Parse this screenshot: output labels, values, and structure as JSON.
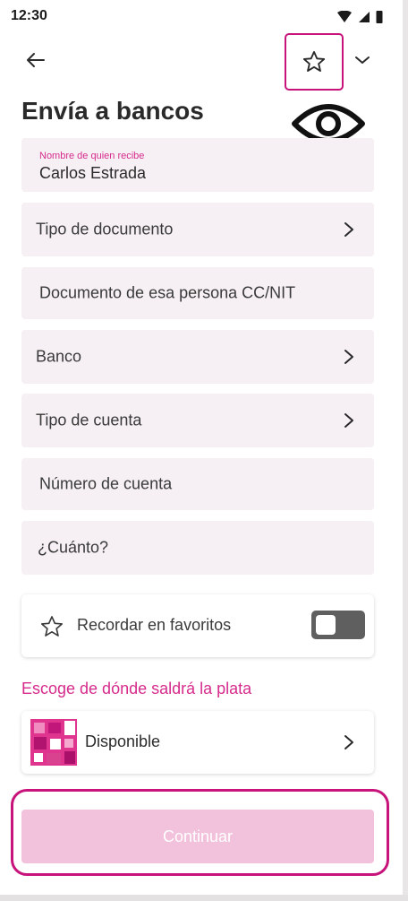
{
  "status_bar": {
    "time": "12:30",
    "icons": [
      "wifi-icon",
      "signal-icon",
      "battery-icon"
    ]
  },
  "header": {
    "title": "Envía a bancos",
    "icons": [
      "back-arrow-icon",
      "star-icon",
      "chevron-down-icon",
      "eye-icon"
    ]
  },
  "form": {
    "recipient": {
      "floating_label": "Nombre de quien recibe",
      "value": "Carlos Estrada"
    },
    "document_type": {
      "label": "Tipo de documento"
    },
    "document_number": {
      "label": "Documento de esa persona CC/NIT"
    },
    "bank": {
      "label": "Banco"
    },
    "account_type": {
      "label": "Tipo de cuenta"
    },
    "account_number": {
      "label": "Número de cuenta"
    },
    "amount": {
      "label": "¿Cuánto?"
    }
  },
  "favorites": {
    "label": "Recordar en favoritos",
    "toggle_on": false
  },
  "source": {
    "title": "Escoge de dónde saldrá la plata",
    "account_label": "Disponible"
  },
  "actions": {
    "continue_label": "Continuar"
  },
  "colors": {
    "accent": "#c8137a",
    "floating_label": "#d62b8c",
    "field_bg": "#f6f0f4",
    "button_disabled": "#f2c1db",
    "toggle_off": "#5f5f5f"
  }
}
